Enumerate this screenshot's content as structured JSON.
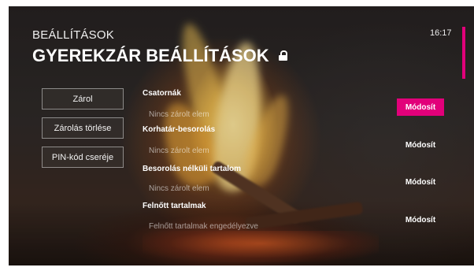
{
  "header": {
    "breadcrumb": "BEÁLLÍTÁSOK",
    "title": "GYEREKZÁR BEÁLLÍTÁSOK",
    "title_icon": "lock-icon",
    "clock": "16:17"
  },
  "colors": {
    "accent": "#e2007a",
    "text": "#ffffff",
    "muted_text": "#9a9a9a"
  },
  "left_menu": [
    {
      "label": "Zárol"
    },
    {
      "label": "Zárolás törlése"
    },
    {
      "label": "PIN-kód cseréje"
    }
  ],
  "sections": [
    {
      "label": "Csatornák",
      "value": "Nincs zárolt elem",
      "action": "Módosít",
      "focused": true
    },
    {
      "label": "Korhatár-besorolás",
      "value": "Nincs zárolt elem",
      "action": "Módosít",
      "focused": false
    },
    {
      "label": "Besorolás nélküli tartalom",
      "value": "Nincs zárolt elem",
      "action": "Módosít",
      "focused": false
    },
    {
      "label": "Felnőtt tartalmak",
      "value": "Felnőtt tartalmak engedélyezve",
      "action": "Módosít",
      "focused": false
    }
  ]
}
